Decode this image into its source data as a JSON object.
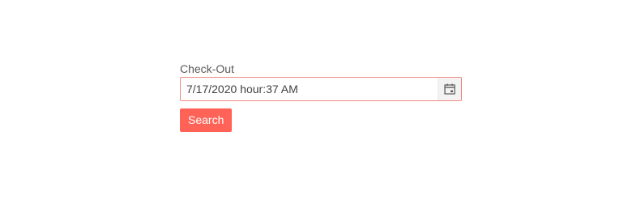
{
  "form": {
    "checkout_label": "Check-Out",
    "checkout_value": "7/17/2020 hour:37 AM",
    "calendar_icon": "calendar-icon",
    "search_label": "Search"
  },
  "colors": {
    "accent": "#ff6358",
    "input_border": "#f08a84",
    "label_text": "#5a5a5a",
    "icon_bg": "#f3f3f3"
  }
}
